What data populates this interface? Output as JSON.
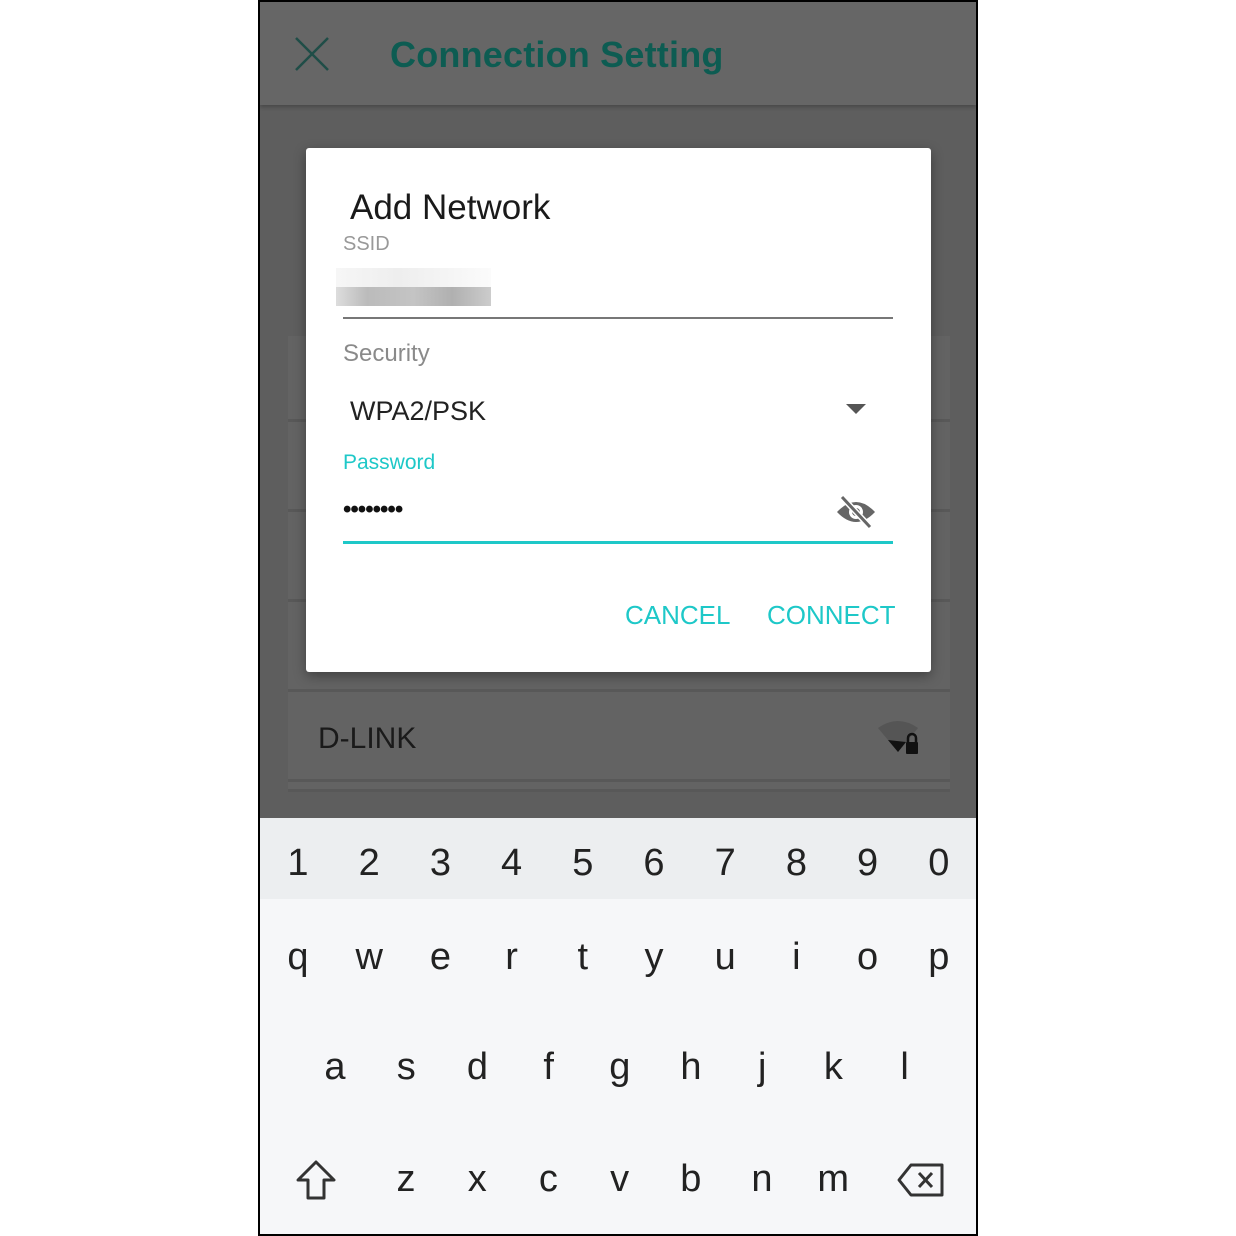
{
  "header": {
    "title": "Connection Setting",
    "close_icon": "close-icon"
  },
  "dialog": {
    "title": "Add Network",
    "ssid_label": "SSID",
    "security_label": "Security",
    "security_value": "WPA2/PSK",
    "password_label": "Password",
    "password_value": "••••••••",
    "cancel": "CANCEL",
    "connect": "CONNECT"
  },
  "networks": [
    {
      "name": "D-LINK",
      "icon": "wifi-lock-icon"
    }
  ],
  "keyboard": {
    "numbers": [
      "1",
      "2",
      "3",
      "4",
      "5",
      "6",
      "7",
      "8",
      "9",
      "0"
    ],
    "row1": [
      "q",
      "w",
      "e",
      "r",
      "t",
      "y",
      "u",
      "i",
      "o",
      "p"
    ],
    "row2": [
      "a",
      "s",
      "d",
      "f",
      "g",
      "h",
      "j",
      "k",
      "l"
    ],
    "row3": [
      "z",
      "x",
      "c",
      "v",
      "b",
      "n",
      "m"
    ]
  },
  "colors": {
    "accent": "#1ec8c8",
    "title": "#0d5c52"
  }
}
